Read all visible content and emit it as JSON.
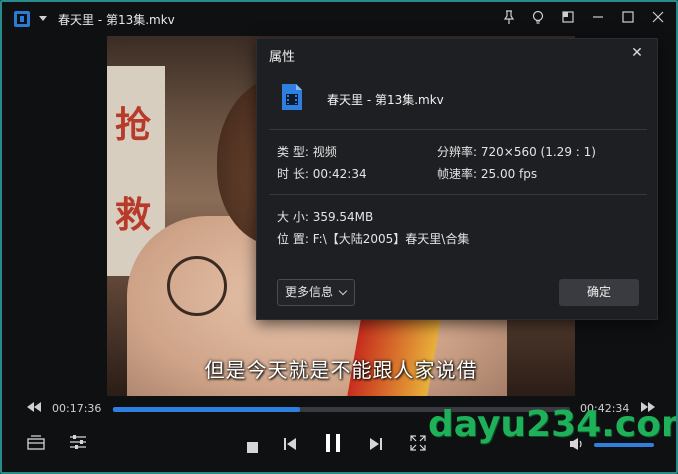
{
  "window": {
    "title": "春天里 - 第13集.mkv",
    "accent": "#2f7fe0",
    "frame_color": "#2a8a8a"
  },
  "titlebar_icons": [
    "pin-icon",
    "lightbulb-icon",
    "mini-mode-icon",
    "minimize-icon",
    "maximize-icon",
    "close-icon"
  ],
  "video": {
    "subtitle": "但是今天就是不能跟人家说借",
    "sign_chars": [
      "抢",
      "救"
    ]
  },
  "dialog": {
    "title": "属性",
    "file_name": "春天里 - 第13集.mkv",
    "type_label": "类 型:",
    "type_value": "视频",
    "resolution_label": "分辨率:",
    "resolution_value": "720×560 (1.29 : 1)",
    "duration_label": "时 长:",
    "duration_value": "00:42:34",
    "framerate_label": "帧速率:",
    "framerate_value": "25.00 fps",
    "size_label": "大 小:",
    "size_value": "359.54MB",
    "location_label": "位 置:",
    "location_value": "F:\\【大陆2005】春天里\\合集",
    "more_info_label": "更多信息",
    "ok_label": "确定"
  },
  "player": {
    "current_time": "00:17:36",
    "total_time": "00:42:34",
    "progress": 0.41,
    "volume": 1.0
  },
  "watermark": "dayu234.com"
}
